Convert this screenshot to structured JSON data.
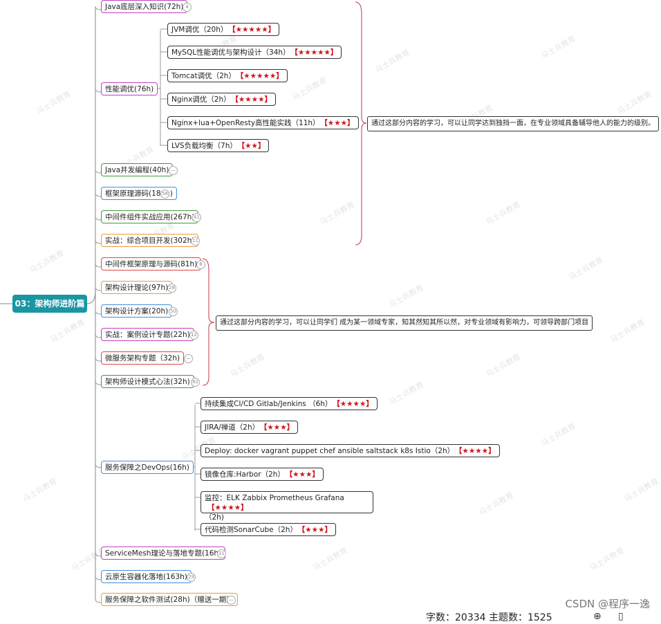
{
  "root": {
    "label": "03：架构师进阶篇"
  },
  "groupA": [
    {
      "label": "Java底层深入知识(72h)",
      "badge": "4",
      "color": "#c03fc0"
    },
    {
      "label": "性能调优(76h)",
      "badge": "",
      "color": "#c03fc0"
    },
    {
      "label": "Java并发编程(40h)",
      "badge": "—",
      "color": "#3d9a3d"
    },
    {
      "label": "框架原理源码(184h)",
      "badge": "58",
      "color": "#3f8ee0"
    },
    {
      "label": "中间件组件实战应用(267h)",
      "badge": "41",
      "color": "#3d9a3d"
    },
    {
      "label": "实战：综合项目开发(302h)",
      "badge": "11",
      "color": "#e89a3a"
    }
  ],
  "perf": [
    {
      "label": "JVM调优（20h）",
      "stars": "【★★★★★】"
    },
    {
      "label": "MySQL性能调优与架构设计（34h）",
      "stars": "【★★★★★】"
    },
    {
      "label": "Tomcat调优（2h）",
      "stars": "【★★★★★】"
    },
    {
      "label": "Nginx调优（2h）",
      "stars": "【★★★★】"
    },
    {
      "label": "Nginx+lua+OpenResty高性能实践（11h）",
      "stars": "【★★★】"
    },
    {
      "label": "LVS负载均衡（7h）",
      "stars": "【★★】"
    }
  ],
  "noteA": "通过这部分内容的学习，可以让同学达到独挡一面，在专业领域具备辅导他人的能力的级别。",
  "groupB": [
    {
      "label": "中间件框架原理与源码(81h)",
      "badge": "8",
      "color": "#e04646"
    },
    {
      "label": "架构设计理论(97h)",
      "badge": "28",
      "color": "#e89a3a"
    },
    {
      "label": "架构设计方案(20h)",
      "badge": "50",
      "color": "#3f8ee0"
    },
    {
      "label": "实战：案例设计专题(22h)",
      "badge": "12",
      "color": "#c03fc0"
    },
    {
      "label": "微服务架构专题（32h)",
      "badge": "—",
      "color": "#e04646"
    },
    {
      "label": "架构师设计模式心法(32h)",
      "badge": "82",
      "color": "#3d9a3d"
    }
  ],
  "noteB": "通过这部分内容的学习，可以让同学们 成为某一领域专家，知其然知其所以然，对专业领域有影响力，可领导跨部门项目",
  "devops": {
    "label": "服务保障之DevOps(16h)",
    "color": "#3f8ee0"
  },
  "devopsItems": [
    {
      "label": "持续集成CI/CD Gitlab/Jenkins （6h）",
      "stars": "【★★★★】"
    },
    {
      "label": "JIRA/禅道（2h）",
      "stars": "【★★★】"
    },
    {
      "label": "Deploy: docker vagrant puppet chef ansible saltstack k8s Istio（2h）",
      "stars": "【★★★★】"
    },
    {
      "label": "镜像仓库:Harbor（2h）",
      "stars": "【★★★】"
    },
    {
      "label": "监控：ELK Zabbix Prometheus Grafana",
      "line2": "（2h)",
      "stars": "【★★★★】"
    },
    {
      "label": "代码检测SonarCube（2h）",
      "stars": "【★★★】"
    }
  ],
  "groupC": [
    {
      "label": "ServiceMesh理论与落地专题(16h)",
      "badge": "11",
      "color": "#c03fc0"
    },
    {
      "label": "云原生容器化落地(163h)",
      "badge": "29",
      "color": "#3f8ee0"
    },
    {
      "label": "服务保障之软件测试(28h)（赠送一期）",
      "badge": "—",
      "color": "#e89a3a"
    }
  ],
  "watermark": "马士兵教育",
  "csdn": "CSDN @程序一逸",
  "footer": "字数：20334   主题数：1525"
}
